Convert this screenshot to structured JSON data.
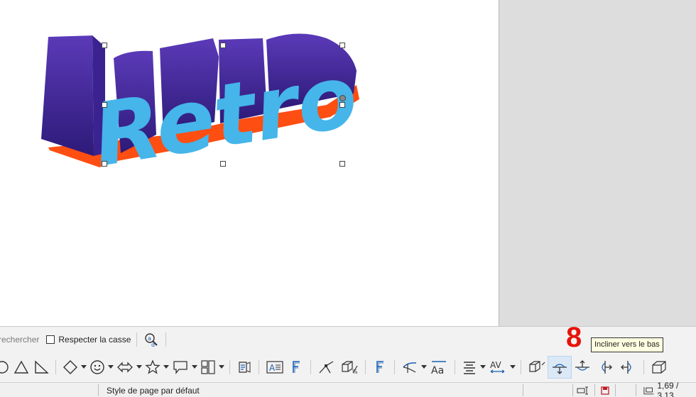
{
  "canvas": {
    "fontwork_text": "Retro",
    "colors": {
      "face": "#45b5ea",
      "extrusion": "#4a2aa0",
      "shadow": "#ff4e12",
      "page": "#ffffff",
      "background": "#dddddd"
    }
  },
  "find_toolbar": {
    "search_text": "rechercher",
    "match_case_label": "Respecter la casse",
    "match_case_checked": false
  },
  "drawing_toolbar": {
    "tools": [
      "ellipse-icon",
      "triangle-icon",
      "right-triangle-icon",
      "diamond-icon",
      "smiley-icon",
      "double-arrow-icon",
      "star-icon",
      "callout-icon",
      "flowchart-icon",
      "insert-text-icon",
      "text-box-icon",
      "fontwork-icon",
      "points-icon",
      "toggle-extrusion-icon",
      "fontwork-gallery-icon",
      "fontwork-shape-icon",
      "fontwork-same-height-icon",
      "fontwork-alignment-icon",
      "character-spacing-icon",
      "extrusion-toggle-icon",
      "tilt-down-icon",
      "tilt-up-icon",
      "tilt-left-icon",
      "tilt-right-icon",
      "depth-icon"
    ],
    "active_tool": "tilt-down-icon",
    "fontwork_letter": "F",
    "case_label": "Aa",
    "spacing_label": "AV"
  },
  "annotation": {
    "badge": "8",
    "tooltip": "Incliner vers le bas",
    "badge_color": "#e8120c"
  },
  "status_bar": {
    "page_style": "Style de page par défaut",
    "position": "1,69 / 3,13"
  }
}
